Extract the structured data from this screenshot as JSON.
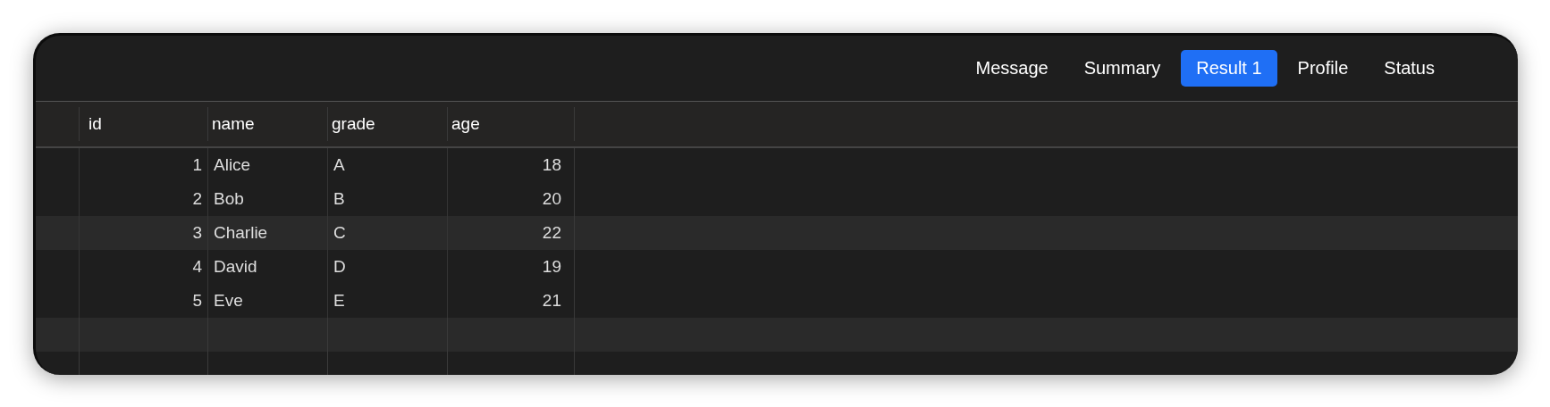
{
  "tabs": [
    {
      "label": "Message",
      "selected": false
    },
    {
      "label": "Summary",
      "selected": false
    },
    {
      "label": "Result 1",
      "selected": true
    },
    {
      "label": "Profile",
      "selected": false
    },
    {
      "label": "Status",
      "selected": false
    }
  ],
  "table": {
    "columns": [
      {
        "label": "id",
        "kind": "number"
      },
      {
        "label": "name",
        "kind": "text"
      },
      {
        "label": "grade",
        "kind": "text"
      },
      {
        "label": "age",
        "kind": "number"
      }
    ],
    "rows": [
      {
        "cells": [
          "1",
          "Alice",
          "A",
          "18"
        ],
        "highlighted": false
      },
      {
        "cells": [
          "2",
          "Bob",
          "B",
          "20"
        ],
        "highlighted": false
      },
      {
        "cells": [
          "3",
          "Charlie",
          "C",
          "22"
        ],
        "highlighted": true
      },
      {
        "cells": [
          "4",
          "David",
          "D",
          "19"
        ],
        "highlighted": false
      },
      {
        "cells": [
          "5",
          "Eve",
          "E",
          "21"
        ],
        "highlighted": false
      }
    ]
  }
}
